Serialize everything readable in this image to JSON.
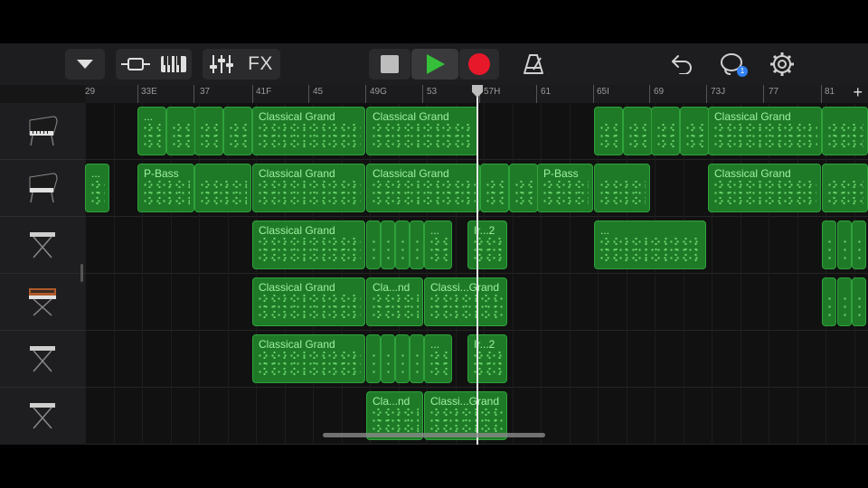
{
  "toolbar": {
    "fx_label": "FX",
    "notification_count": "1"
  },
  "ruler": {
    "labels": [
      "29",
      "33E",
      "37",
      "41F",
      "45",
      "49G",
      "53",
      "57H",
      "61",
      "65I",
      "69",
      "73J",
      "77",
      "81"
    ],
    "add": "+"
  },
  "tracks": [
    {
      "name": "grand-piano",
      "icon": "grand-piano-icon"
    },
    {
      "name": "grand-piano-2",
      "icon": "grand-piano-icon"
    },
    {
      "name": "keyboard-stand",
      "icon": "keyboard-stand-icon"
    },
    {
      "name": "synth",
      "icon": "vintage-synth-icon"
    },
    {
      "name": "keyboard-stand-2",
      "icon": "keyboard-stand-icon"
    },
    {
      "name": "keyboard-stand-3",
      "icon": "keyboard-stand-icon"
    }
  ],
  "regions": {
    "t0": [
      "...",
      "",
      "",
      "",
      "Classical Grand",
      "Classical Grand",
      "",
      "",
      "",
      "",
      "Classical Grand",
      ""
    ],
    "t1": [
      "...",
      "P-Bass",
      "",
      "Classical Grand",
      "Classical Grand",
      "",
      "",
      "P-Bass",
      "",
      "Classical Grand",
      ""
    ],
    "t2": [
      "Classical Grand",
      "",
      "",
      "",
      "",
      "...",
      "Ir...2",
      "...",
      "",
      "",
      "",
      ""
    ],
    "t3": [
      "Classical Grand",
      "Cla...nd",
      "Classi...Grand",
      "",
      "",
      ""
    ],
    "t4": [
      "Classical Grand",
      "",
      "",
      "",
      "",
      "...",
      "Ir...2"
    ],
    "t5": [
      "Cla...nd",
      "Classi...Grand"
    ]
  },
  "colors": {
    "region_fill": "#1f7a28",
    "region_border": "#2ea23a",
    "play": "#36c03a",
    "record": "#e8182b"
  }
}
